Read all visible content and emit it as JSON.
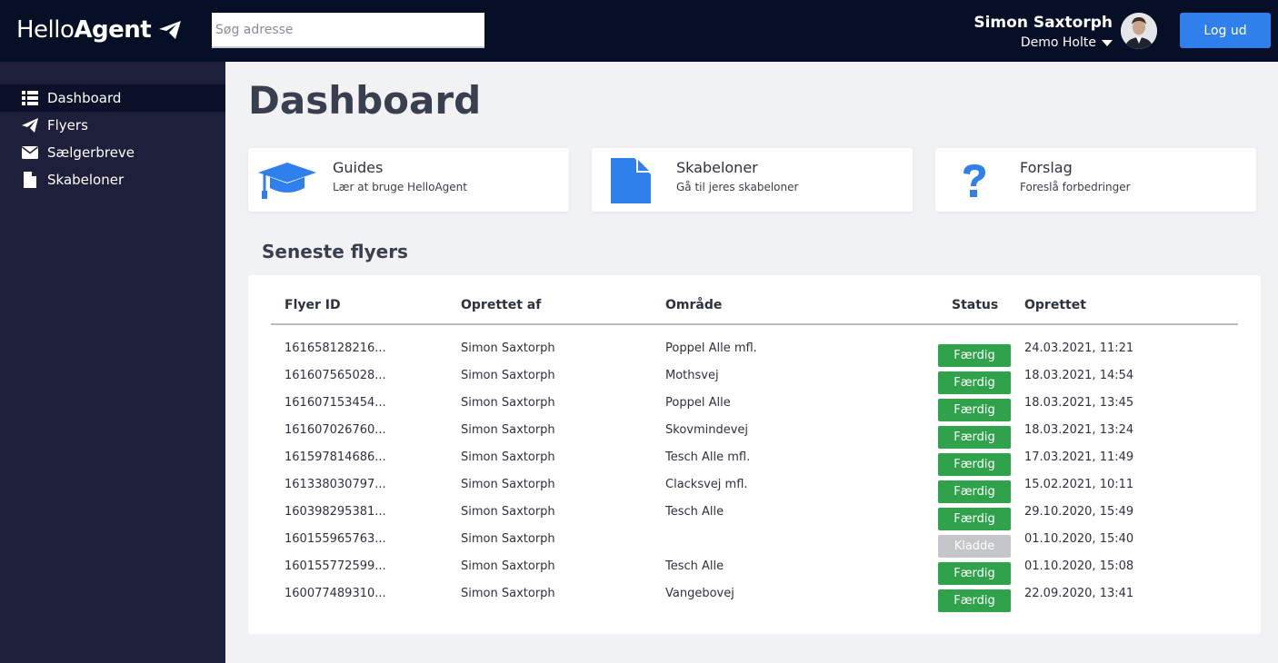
{
  "header": {
    "logo_hello": "Hello",
    "logo_agent": "Agent",
    "search_placeholder": "Søg adresse",
    "user_name": "Simon Saxtorph",
    "user_org": "Demo Holte",
    "logout_label": "Log ud"
  },
  "sidebar": {
    "items": [
      {
        "label": "Dashboard",
        "icon": "list-icon",
        "active": true
      },
      {
        "label": "Flyers",
        "icon": "paper-plane-icon",
        "active": false
      },
      {
        "label": "Sælgerbreve",
        "icon": "envelope-icon",
        "active": false
      },
      {
        "label": "Skabeloner",
        "icon": "file-icon",
        "active": false
      }
    ]
  },
  "main": {
    "title": "Dashboard",
    "cards": [
      {
        "title": "Guides",
        "subtitle": "Lær at bruge HelloAgent",
        "icon": "graduation-cap-icon"
      },
      {
        "title": "Skabeloner",
        "subtitle": "Gå til jeres skabeloner",
        "icon": "file-icon"
      },
      {
        "title": "Forslag",
        "subtitle": "Foreslå forbedringer",
        "icon": "question-icon"
      }
    ],
    "section_title": "Seneste flyers",
    "table": {
      "columns": [
        "Flyer ID",
        "Oprettet af",
        "Område",
        "Status",
        "Oprettet"
      ],
      "rows": [
        [
          "161658128216...",
          "Simon Saxtorph",
          "Poppel Alle mfl.",
          "Færdig",
          "24.03.2021, 11:21"
        ],
        [
          "161607565028...",
          "Simon Saxtorph",
          "Mothsvej",
          "Færdig",
          "18.03.2021, 14:54"
        ],
        [
          "161607153454...",
          "Simon Saxtorph",
          "Poppel Alle",
          "Færdig",
          "18.03.2021, 13:45"
        ],
        [
          "161607026760...",
          "Simon Saxtorph",
          "Skovmindevej",
          "Færdig",
          "18.03.2021, 13:24"
        ],
        [
          "161597814686...",
          "Simon Saxtorph",
          "Tesch Alle mfl.",
          "Færdig",
          "17.03.2021, 11:49"
        ],
        [
          "161338030797...",
          "Simon Saxtorph",
          "Clacksvej mfl.",
          "Færdig",
          "15.02.2021, 10:11"
        ],
        [
          "160398295381...",
          "Simon Saxtorph",
          "Tesch Alle",
          "Færdig",
          "29.10.2020, 15:49"
        ],
        [
          "160155965763...",
          "Simon Saxtorph",
          "",
          "Kladde",
          "01.10.2020, 15:40"
        ],
        [
          "160155772599...",
          "Simon Saxtorph",
          "Tesch Alle",
          "Færdig",
          "01.10.2020, 15:08"
        ],
        [
          "160077489310...",
          "Simon Saxtorph",
          "Vangebovej",
          "Færdig",
          "22.09.2020, 13:41"
        ]
      ]
    }
  },
  "colors": {
    "topbar": "#070f27",
    "sidebar": "#1e1f3a",
    "accent": "#2f80ed",
    "status_done": "#31a24c",
    "status_draft": "#c4c6ca"
  }
}
